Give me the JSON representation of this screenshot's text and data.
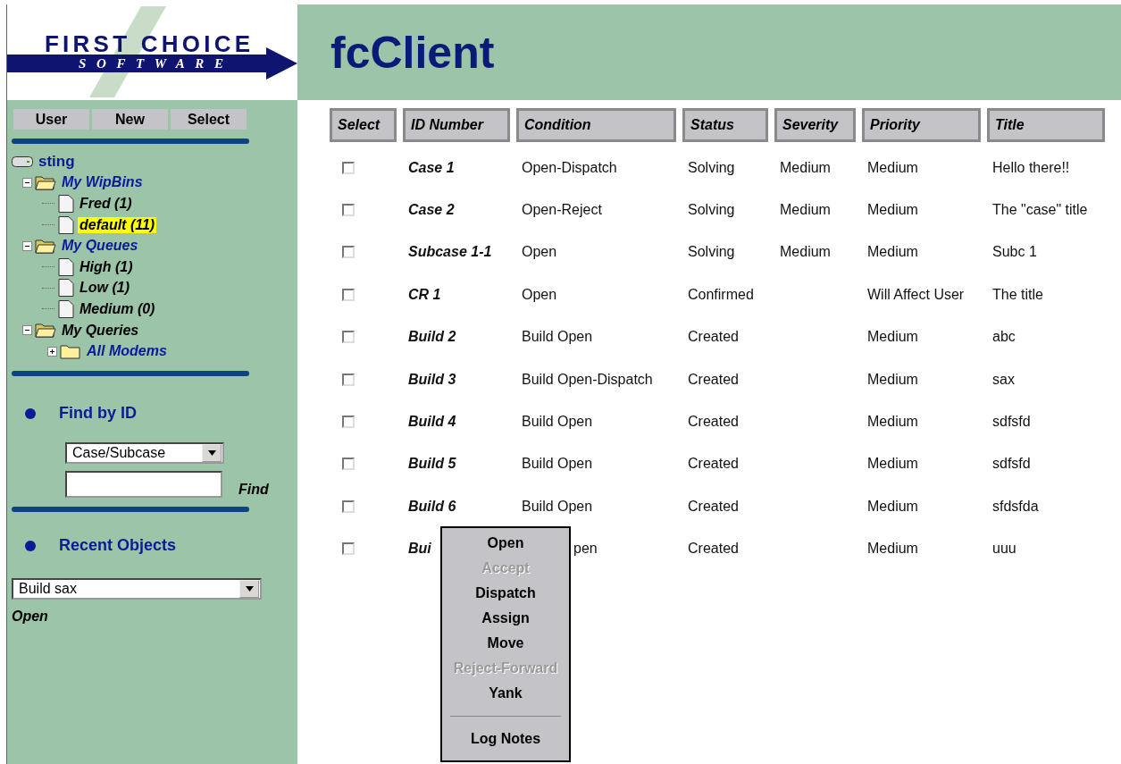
{
  "logo": {
    "line1": "FIRST CHOICE",
    "line2": "SOFTWARE"
  },
  "app_title": "fcClient",
  "sidebar": {
    "buttons": [
      "User",
      "New",
      "Select"
    ],
    "tree": [
      {
        "label": "sting",
        "kind": "drive",
        "selected": false,
        "children": [
          {
            "label": "My WipBins",
            "kind": "folder",
            "link": true,
            "selected": false,
            "expanded": true,
            "children": [
              {
                "label": "Fred (1)",
                "kind": "document",
                "link": false,
                "selected": false
              },
              {
                "label": "default (11)",
                "kind": "document",
                "link": false,
                "selected": true
              }
            ]
          },
          {
            "label": "My Queues",
            "kind": "folder",
            "link": true,
            "selected": false,
            "expanded": true,
            "children": [
              {
                "label": "High (1)",
                "kind": "document",
                "link": false,
                "selected": false
              },
              {
                "label": "Low (1)",
                "kind": "document",
                "link": false,
                "selected": false
              },
              {
                "label": "Medium (0)",
                "kind": "document",
                "link": false,
                "selected": false
              }
            ]
          },
          {
            "label": "My Queries",
            "kind": "folder",
            "link": false,
            "selected": false,
            "expanded": true,
            "children": [
              {
                "label": "All Modems",
                "kind": "folder",
                "link": true,
                "selected": false,
                "expanded": false
              }
            ]
          }
        ]
      }
    ],
    "find_by_id": {
      "heading": "Find by ID",
      "type_value": "Case/Subcase",
      "find_label": "Find"
    },
    "recent_objects": {
      "heading": "Recent Objects",
      "value": "Build sax",
      "open_label": "Open"
    }
  },
  "table": {
    "columns": [
      "Select",
      "ID Number",
      "Condition",
      "Status",
      "Severity",
      "Priority",
      "Title"
    ],
    "rows": [
      {
        "checked": false,
        "id": "Case 1",
        "condition": "Open-Dispatch",
        "status": "Solving",
        "severity": "Medium",
        "priority": "Medium",
        "title": "Hello there!!"
      },
      {
        "checked": false,
        "id": "Case 2",
        "condition": "Open-Reject",
        "status": "Solving",
        "severity": "Medium",
        "priority": "Medium",
        "title": "The \"case\" title"
      },
      {
        "checked": false,
        "id": "Subcase 1-1",
        "condition": "Open",
        "status": "Solving",
        "severity": "Medium",
        "priority": "Medium",
        "title": "Subc 1"
      },
      {
        "checked": false,
        "id": "CR 1",
        "condition": "Open",
        "status": "Confirmed",
        "priority": "Will Affect User",
        "title": "The title"
      },
      {
        "checked": false,
        "id": "Build 2",
        "condition": "Build Open",
        "status": "Created",
        "priority": "Medium",
        "title": "abc"
      },
      {
        "checked": false,
        "id": "Build 3",
        "condition": "Build Open-Dispatch",
        "status": "Created",
        "priority": "Medium",
        "title": "sax"
      },
      {
        "checked": false,
        "id": "Build 4",
        "condition": "Build Open",
        "status": "Created",
        "priority": "Medium",
        "title": "sdfsfd"
      },
      {
        "checked": false,
        "id": "Build 5",
        "condition": "Build Open",
        "status": "Created",
        "priority": "Medium",
        "title": "sdfsfd"
      },
      {
        "checked": false,
        "id": "Build 6",
        "condition": "Build Open",
        "status": "Created",
        "priority": "Medium",
        "title": "sfdsfda"
      },
      {
        "checked": false,
        "id": "Bui",
        "condition": "pen",
        "covered_by_menu": true,
        "status": "Created",
        "priority": "Medium",
        "title": "uuu"
      }
    ]
  },
  "context_menu": [
    {
      "kind": "item",
      "label": "Open",
      "disabled": false
    },
    {
      "kind": "item",
      "label": "Accept",
      "disabled": true
    },
    {
      "kind": "item",
      "label": "Dispatch",
      "disabled": false
    },
    {
      "kind": "item",
      "label": "Assign",
      "disabled": false
    },
    {
      "kind": "item",
      "label": "Move",
      "disabled": false
    },
    {
      "kind": "item",
      "label": "Reject-Forward",
      "disabled": true
    },
    {
      "kind": "item",
      "label": "Yank",
      "disabled": false
    },
    {
      "kind": "separator"
    },
    {
      "kind": "item",
      "label": "Log Notes",
      "disabled": false
    }
  ]
}
